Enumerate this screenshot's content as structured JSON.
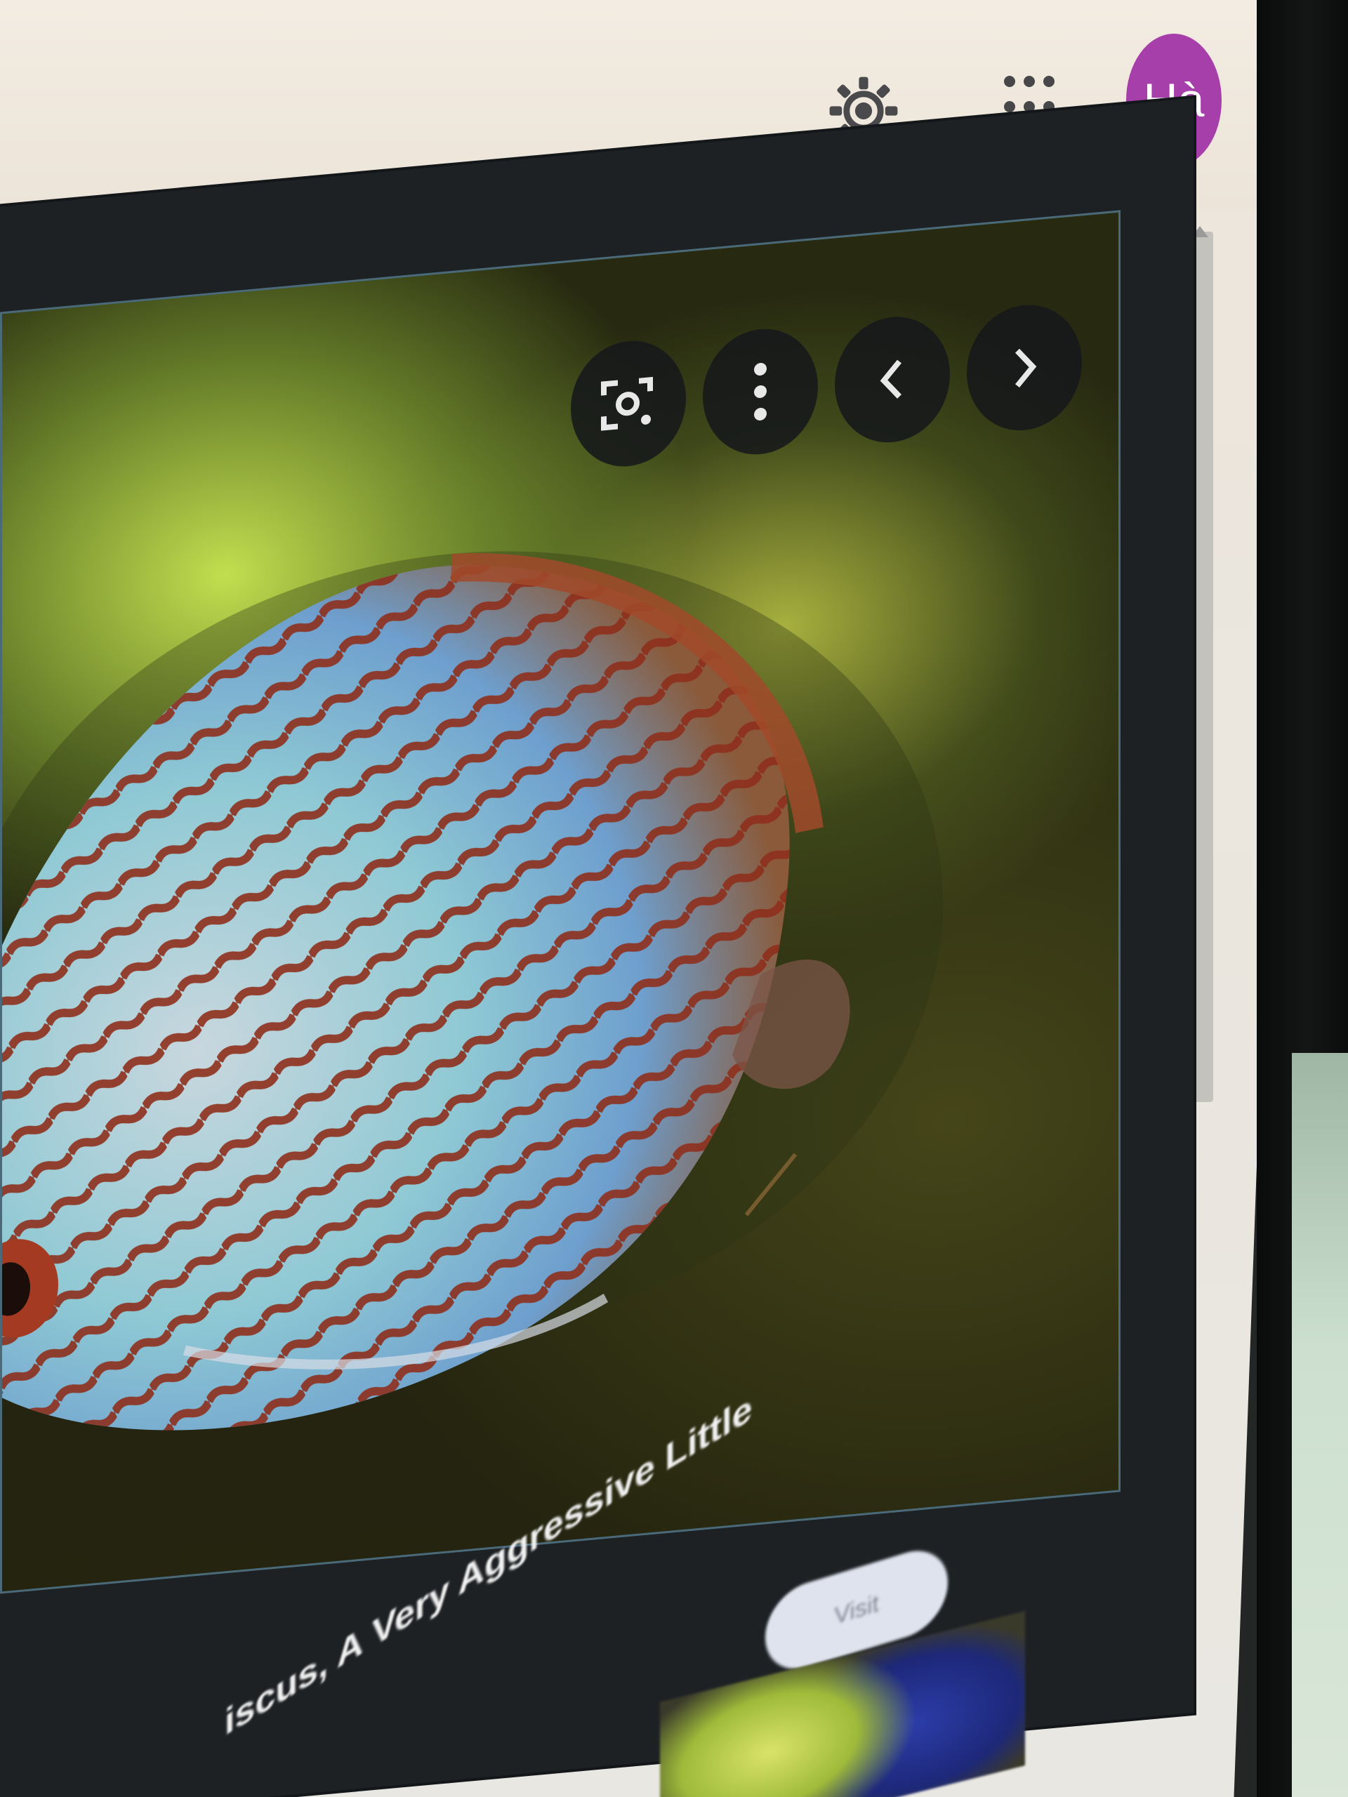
{
  "header": {
    "settings_icon": "gear-icon",
    "apps_icon": "apps-grid-icon",
    "avatar_initials": "Hà",
    "avatar_color": "#a63fa9"
  },
  "viewer": {
    "controls": [
      {
        "name": "lens-search-icon"
      },
      {
        "name": "more-options-icon"
      },
      {
        "name": "previous-icon"
      },
      {
        "name": "next-icon"
      }
    ],
    "caption": "iscus, A Very Aggressive Little",
    "visit_label": "Visit"
  }
}
